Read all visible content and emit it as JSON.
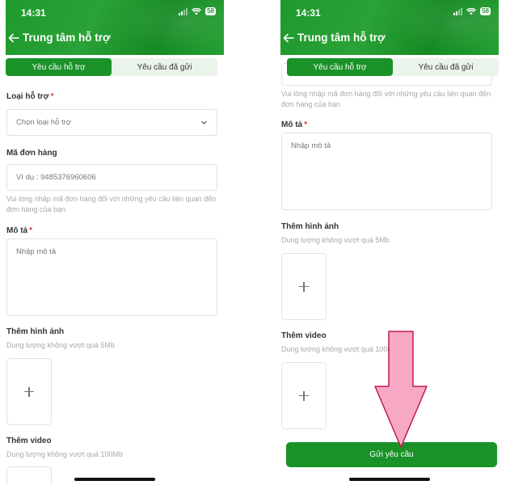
{
  "status": {
    "time": "14:31",
    "battery": "58"
  },
  "header": {
    "title": "Trung tâm hỗ trợ",
    "back_icon": "arrow-left-icon"
  },
  "tabs": [
    {
      "label": "Yêu cầu hỗ trợ",
      "active": true
    },
    {
      "label": "Yêu cầu đã gửi",
      "active": false
    }
  ],
  "form": {
    "support_type": {
      "label": "Loại hỗ trợ",
      "required_mark": "*",
      "placeholder": "Chọn loại hỗ trợ"
    },
    "order_code": {
      "label": "Mã đơn hàng",
      "placeholder": "Ví dụ : 9485376960606",
      "hint": "Vui lòng nhập mã đơn hàng đối với những yêu cầu liên quan đến đơn hàng của bạn"
    },
    "description": {
      "label": "Mô tả",
      "required_mark": "*",
      "placeholder": "Nhập mô tả"
    },
    "image": {
      "label": "Thêm hình ảnh",
      "hint": "Dung lượng không vượt quá 5Mb"
    },
    "video": {
      "label": "Thêm video",
      "hint": "Dung lượng không vượt quá 100Mb"
    },
    "submit_label": "Gửi yêu cầu"
  },
  "colors": {
    "brand_green": "#1a9228",
    "annotation_arrow": "#f7a8c4",
    "required": "#e53935"
  }
}
